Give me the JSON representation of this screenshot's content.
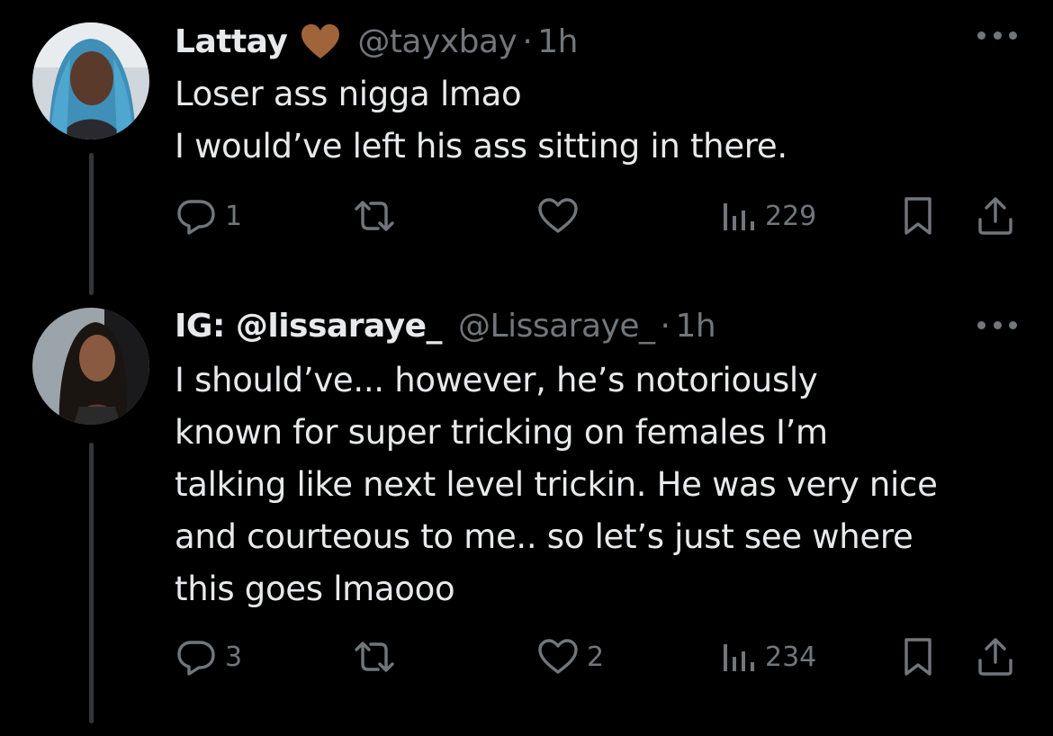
{
  "tweets": [
    {
      "display_name": "Lattay",
      "badge_icon": "brown-heart-icon",
      "badge_color": "#a0643a",
      "handle": "@tayxbay",
      "separator": "·",
      "time": "1h",
      "lines": [
        "Loser ass nigga lmao",
        "I would’ve left his ass sitting in there."
      ],
      "replies": "1",
      "retweets": "",
      "likes": "",
      "views": "229"
    },
    {
      "display_name": "IG: @lissaraye_",
      "handle": "@Lissaraye_",
      "separator": "·",
      "time": "1h",
      "lines": [
        "I should’ve... however, he’s notoriously",
        "known for super tricking on females I’m",
        "talking like next level trickin. He was very nice",
        "and courteous to me.. so let’s just see where",
        "this goes lmaooo"
      ],
      "replies": "3",
      "retweets": "",
      "likes": "2",
      "views": "234"
    }
  ],
  "colors": {
    "background": "#000000",
    "text": "#e7e9ea",
    "muted": "#71767b",
    "thread_line": "#333639"
  }
}
